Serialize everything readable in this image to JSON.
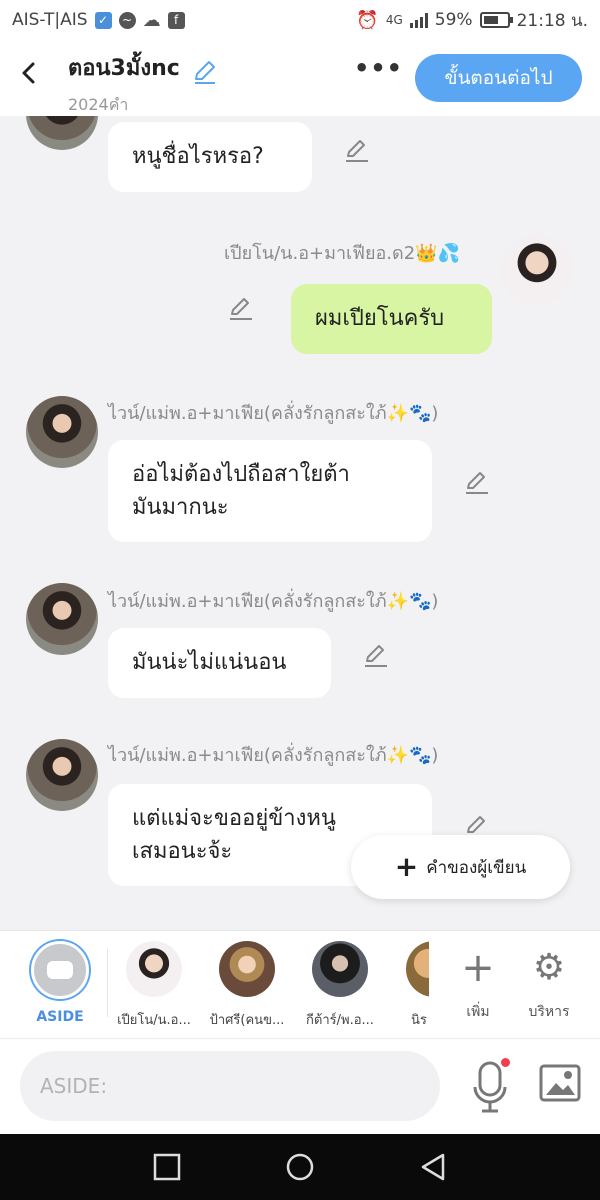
{
  "status_bar": {
    "carrier": "AIS-T|AIS",
    "network": "4G",
    "battery": "59%",
    "time": "21:18 น."
  },
  "header": {
    "title": "ตอน3มั้งnc",
    "word_count": "2024คำ",
    "more_label": "•••",
    "next_button": "ขั้นตอนต่อไป",
    "accent_color": "#5aa6f2"
  },
  "messages": [
    {
      "sender": "",
      "text": "หนูชื่อไรหรอ?",
      "side": "left"
    },
    {
      "sender": "เปียโน/น.อ+มาเฟียอ.ด2👑💦",
      "text": "ผมเปียโนครับ",
      "side": "right"
    },
    {
      "sender": "ไวน์/แม่พ.อ+มาเฟีย(คลั่งรักลูกสะใภ้✨🐾)",
      "text": "อ่อไม่ต้องไปถือสาใยต้ามันมากนะ",
      "lines": [
        "อ่อไม่ต้องไปถือสาใยต้า",
        "มันมากนะ"
      ],
      "side": "left"
    },
    {
      "sender": "ไวน์/แม่พ.อ+มาเฟีย(คลั่งรักลูกสะใภ้✨🐾)",
      "text": "มันน่ะไม่แน่นอน",
      "side": "left"
    },
    {
      "sender": "ไวน์/แม่พ.อ+มาเฟีย(คลั่งรักลูกสะใภ้✨🐾)",
      "text": "แต่แม่จะขออยู่ข้างหนูเสมอนะจ้ะ",
      "lines": [
        "แต่แม่จะขออยู่ข้างหนู",
        "เสมอนะจ้ะ"
      ],
      "side": "left"
    }
  ],
  "float_button": {
    "plus": "+",
    "label": "คำของผู้เขียน"
  },
  "characters": {
    "aside": "ASIDE",
    "list": [
      "เปียโน/น.อ...",
      "ป้าศรี(คนข...",
      "กีต้าร์/พ.อ...",
      "นิร"
    ]
  },
  "tools": {
    "add_glyph": "+",
    "add": "เพิ่ม",
    "manage_glyph": "⚙",
    "manage": "บริหาร"
  },
  "input": {
    "placeholder": "ASIDE:"
  },
  "colors": {
    "my_bubble": "#d7f5a3",
    "bubble": "#ffffff",
    "background": "#f2f2f4"
  },
  "icons": [
    "chevron-left-icon",
    "pencil-icon",
    "microphone-icon",
    "image-icon",
    "gear-icon",
    "plus-icon",
    "square-icon",
    "circle-icon",
    "triangle-back-icon"
  ]
}
